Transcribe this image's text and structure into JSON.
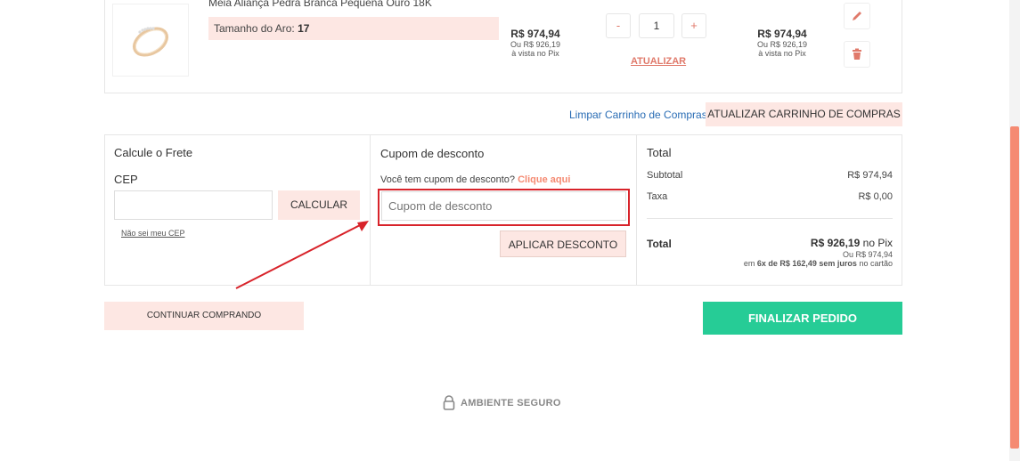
{
  "cart_item": {
    "product_name": "Meia Aliança Pedra Branca Pequena Ouro 18K",
    "variant_label": "Tamanho do Aro:",
    "variant_value": "17",
    "unit_price": "R$ 974,94",
    "unit_price_pix_line1": "Ou R$ 926,19",
    "unit_price_pix_line2": "à vista no Pix",
    "qty_minus": "-",
    "qty_value": "1",
    "qty_plus": "+",
    "update_link": "ATUALIZAR",
    "total_price": "R$ 974,94",
    "total_pix_line1": "Ou R$ 926,19",
    "total_pix_line2": "à vista no Pix"
  },
  "cart_actions": {
    "clear_cart": "Limpar Carrinho de Compras",
    "update_cart": "ATUALIZAR CARRINHO DE COMPRAS"
  },
  "shipping": {
    "title": "Calcule o Frete",
    "cep_label": "CEP",
    "calc_button": "CALCULAR",
    "dont_know_cep": "Não sei meu CEP"
  },
  "coupon": {
    "title": "Cupom de desconto",
    "question": "Você tem cupom de desconto?",
    "click_here": "Clique aqui",
    "placeholder": "Cupom de desconto",
    "apply_button": "APLICAR DESCONTO"
  },
  "totals": {
    "title": "Total",
    "subtotal_label": "Subtotal",
    "subtotal_value": "R$ 974,94",
    "tax_label": "Taxa",
    "tax_value": "R$ 0,00",
    "total_label": "Total",
    "total_pix_value": "R$ 926,19",
    "total_pix_suffix": "no Pix",
    "total_full": "Ou R$ 974,94",
    "installments_prefix": "em",
    "installments_bold": "6x de R$ 162,49 sem juros",
    "installments_suffix": "no cartão"
  },
  "footer": {
    "continue_shopping": "CONTINUAR COMPRANDO",
    "checkout": "FINALIZAR PEDIDO",
    "secure": "AMBIENTE SEGURO"
  },
  "colors": {
    "accent": "#e0796a",
    "peach": "#fde7e3",
    "checkout_green": "#26cc96",
    "highlight_red": "#d8232a"
  }
}
